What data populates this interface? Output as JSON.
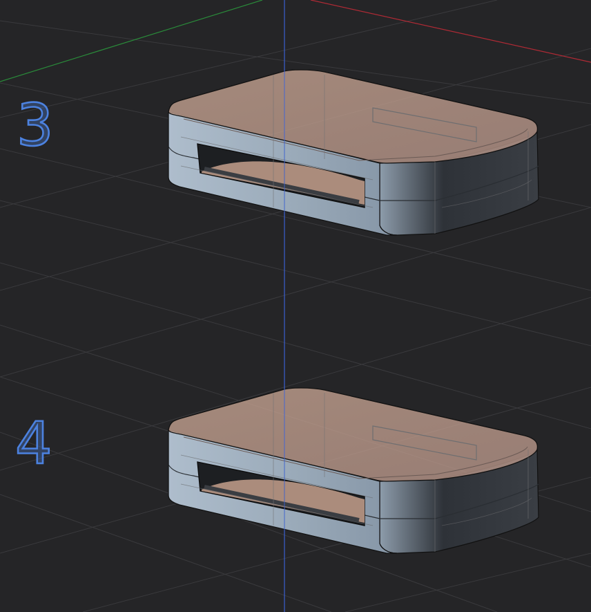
{
  "viewport": {
    "background": "#252527",
    "grid_color": "#3a3a3d",
    "axis_colors": {
      "x": "#b02a35",
      "y": "#2a8a3a",
      "z": "#3a5fcf"
    }
  },
  "models": [
    {
      "label": "3",
      "label_color": "#4c82e0",
      "shell_color": "#a8b8c8",
      "interior_color": "#d0a890"
    },
    {
      "label": "4",
      "label_color": "#4c82e0",
      "shell_color": "#a8b8c8",
      "interior_color": "#d0a890"
    }
  ]
}
